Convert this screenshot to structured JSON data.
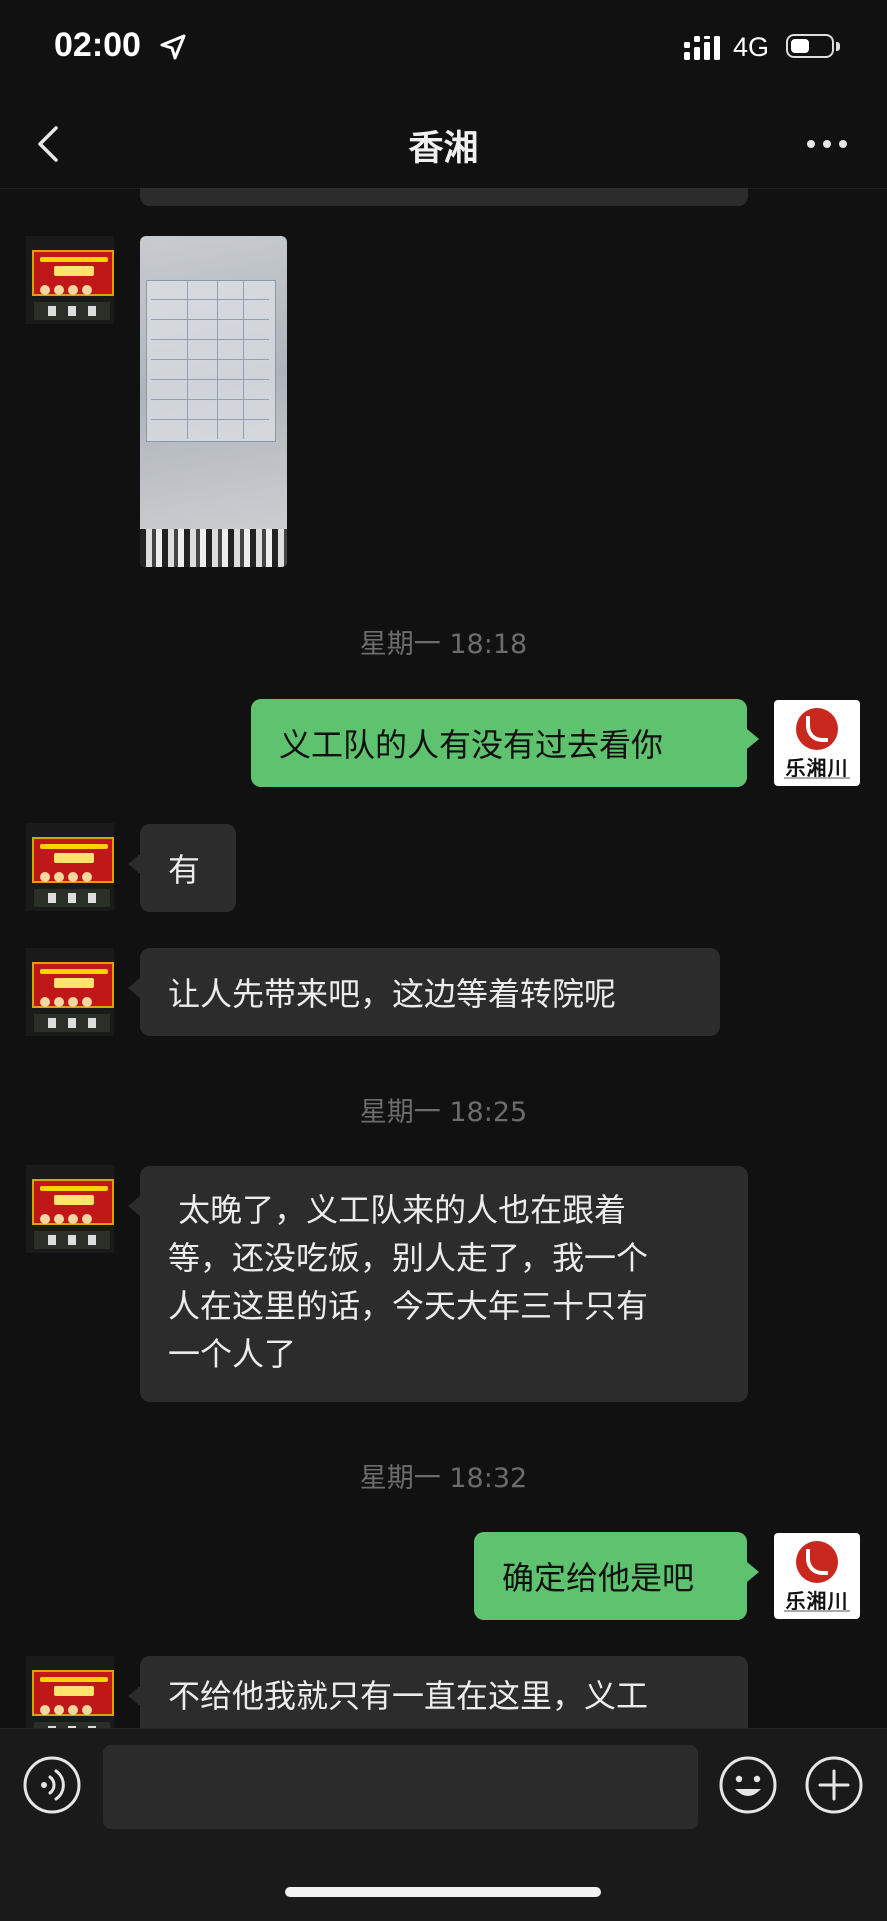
{
  "status_bar": {
    "time": "02:00",
    "network": "4G"
  },
  "header": {
    "title": "香湘"
  },
  "messages": [
    {
      "id": "m1",
      "side": "left",
      "type": "image"
    },
    {
      "id": "t1",
      "type": "timestamp",
      "text": "星期一 18:18"
    },
    {
      "id": "m2",
      "side": "right",
      "type": "text",
      "text": "义工队的人有没有过去看你"
    },
    {
      "id": "m3",
      "side": "left",
      "type": "text",
      "text": "有"
    },
    {
      "id": "m4",
      "side": "left",
      "type": "text",
      "text": "让人先带来吧，这边等着转院呢"
    },
    {
      "id": "t2",
      "type": "timestamp",
      "text": "星期一 18:25"
    },
    {
      "id": "m5",
      "side": "left",
      "type": "text",
      "lines": [
        " 太晚了，义工队来的人也在跟着",
        "等，还没吃饭，别人走了，我一个",
        "人在这里的话，今天大年三十只有",
        "一个人了"
      ]
    },
    {
      "id": "t3",
      "type": "timestamp",
      "text": "星期一 18:32"
    },
    {
      "id": "m6",
      "side": "right",
      "type": "text",
      "text": "确定给他是吧"
    },
    {
      "id": "m7",
      "side": "left",
      "type": "text",
      "text": "不给他我就只有一直在这里，义工"
    }
  ],
  "self_avatar": {
    "logo_text": "乐湘川"
  },
  "input_bar": {
    "message_value": "",
    "voice_icon": "voice-icon",
    "emoji_icon": "emoji-icon",
    "plus_icon": "plus-icon"
  },
  "colors": {
    "background": "#111111",
    "sent_bubble": "#5ec26e",
    "received_bubble": "#2c2c2c",
    "timestamp_text": "#6c6c6c"
  }
}
